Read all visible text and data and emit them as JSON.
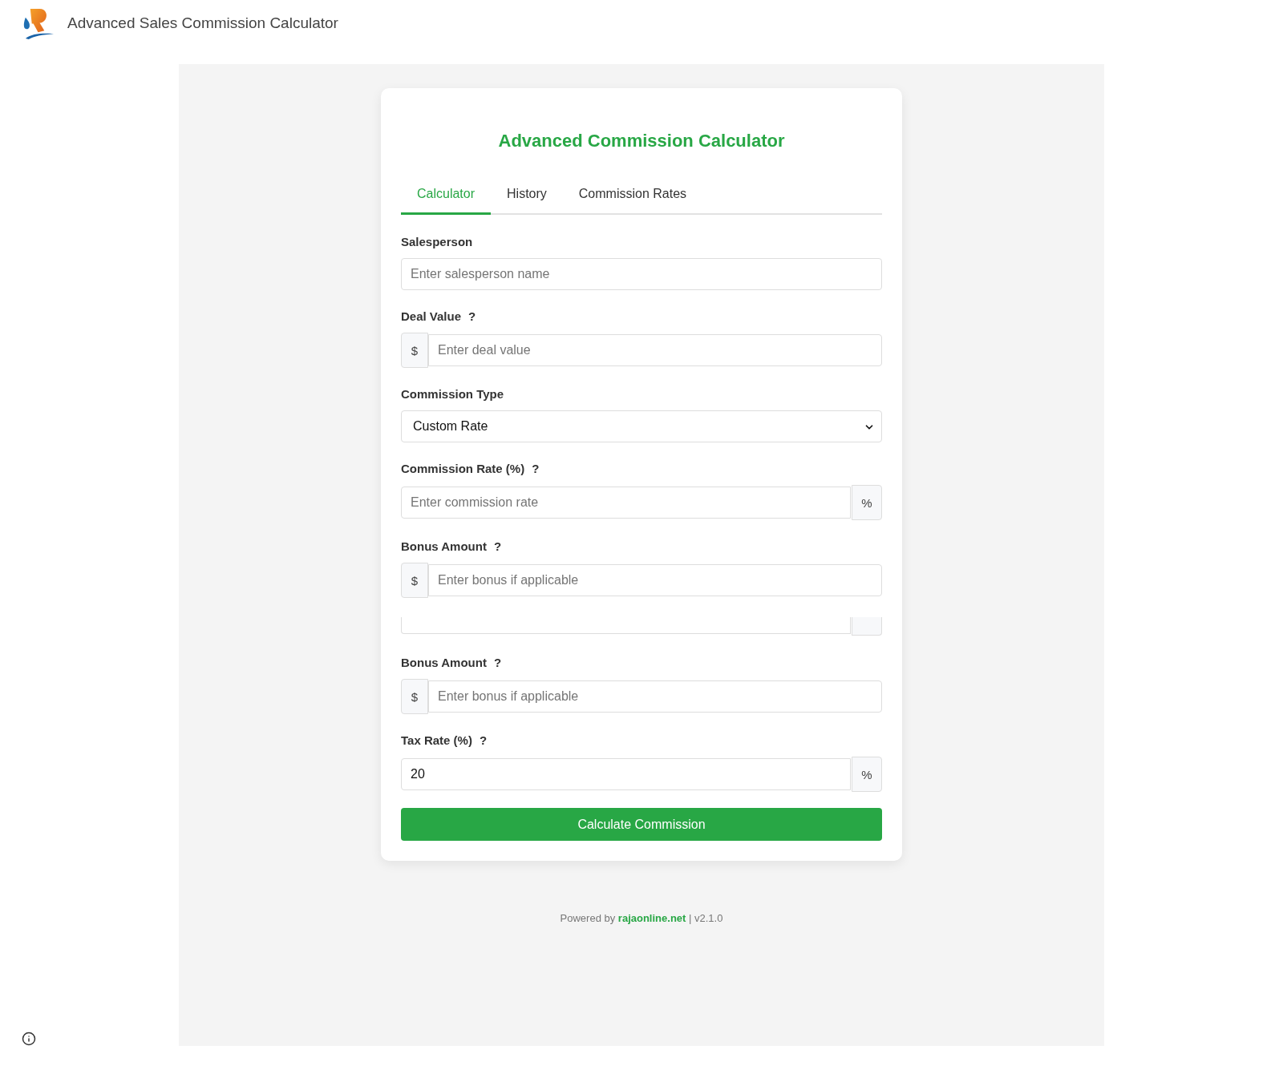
{
  "header": {
    "title": "Advanced Sales Commission Calculator"
  },
  "card": {
    "title": "Advanced Commission Calculator"
  },
  "tabs": [
    {
      "label": "Calculator",
      "selected": true
    },
    {
      "label": "History",
      "selected": false
    },
    {
      "label": "Commission Rates",
      "selected": false
    }
  ],
  "fields": [
    {
      "kind": "input",
      "label": "Salesperson",
      "placeholder": "Enter salesperson name"
    },
    {
      "kind": "input",
      "label": "Deal Value",
      "help": "?",
      "prefix": "$",
      "placeholder": "Enter deal value"
    },
    {
      "kind": "select",
      "label": "Commission Type",
      "value": "Custom Rate"
    },
    {
      "kind": "input",
      "label": "Commission Rate (%)",
      "help": "?",
      "placeholder": "Enter commission rate",
      "suffix": "%"
    },
    {
      "kind": "input",
      "label": "Bonus Amount",
      "help": "?",
      "prefix": "$",
      "placeholder": "Enter bonus if applicable"
    },
    {
      "kind": "clipped",
      "addon": true
    },
    {
      "kind": "input",
      "label": "Bonus Amount",
      "help": "?",
      "prefix": "$",
      "placeholder": "Enter bonus if applicable"
    },
    {
      "kind": "input",
      "label": "Tax Rate (%)",
      "help": "?",
      "value": "20",
      "suffix": "%"
    }
  ],
  "submit_button": "Calculate Commission",
  "footer": {
    "text_before": "Powered by",
    "link": "rajaonline.net",
    "text_after": "| v2.1.0"
  }
}
